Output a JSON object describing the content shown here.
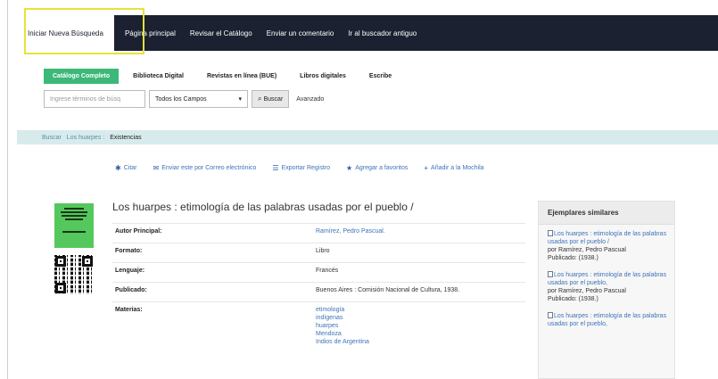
{
  "topnav": {
    "items": [
      "Iniciar Nueva Búsqueda",
      "Página principal",
      "Revisar el Catálogo",
      "Enviar un comentario",
      "Ir al buscador antiguo"
    ]
  },
  "tabs": [
    "Catálogo Completo",
    "Biblioteca Digital",
    "Revistas en línea (BUE)",
    "Libros digitales",
    "Escribe"
  ],
  "search": {
    "placeholder": "Ingrese términos de búsq",
    "field_select": "Todos los Campos",
    "button": "Buscar",
    "advanced": "Avanzado"
  },
  "breadcrumb": {
    "home": "Buscar",
    "record": "Los huarpes :",
    "current": "Existencias"
  },
  "toolbar": {
    "cite": "Citar",
    "email": "Enviar este por Correo electrónico",
    "export": "Exportar Registro",
    "favorites": "Agregar a favoritos",
    "bag": "Añadir a la Mochila"
  },
  "record": {
    "title": "Los huarpes : etimología de las palabras usadas por el pueblo /",
    "fields": [
      {
        "label": "Autor Principal:",
        "value": "Ramírez, Pedro Pascual.",
        "link": true
      },
      {
        "label": "Formato:",
        "value": "Libro",
        "link": false
      },
      {
        "label": "Lenguaje:",
        "value": "Francés",
        "link": false
      },
      {
        "label": "Publicado:",
        "value": "Buenos Aires : Comisión Nacional de Cultura, 1938.",
        "link": false
      }
    ],
    "subjects_label": "Materias:",
    "subjects": [
      "etimología",
      "indígenas",
      "huarpes",
      "Mendoza",
      "Indios de Argentina"
    ]
  },
  "similar": {
    "heading": "Ejemplares similares",
    "items": [
      {
        "title": "Los huarpes : etimología de las palabras usadas por el pueblo /",
        "author": "por Ramírez, Pedro Pascual",
        "published": "Publicado: (1938.)"
      },
      {
        "title": "Los huarpes : etimología de las palabras usadas por el pueblo,",
        "author": "por Ramírez, Pedro Pascual",
        "published": "Publicado: (1938.)"
      },
      {
        "title": "Los huarpes : etimología de las palabras usadas por el pueblo,",
        "author": "",
        "published": ""
      }
    ]
  },
  "colors": {
    "nav_bg": "#1b2130",
    "accent_green": "#3cb878",
    "link_blue": "#3f73b8",
    "breadcrumb_bg": "#d7ebed",
    "highlight": "#e8e23a"
  }
}
